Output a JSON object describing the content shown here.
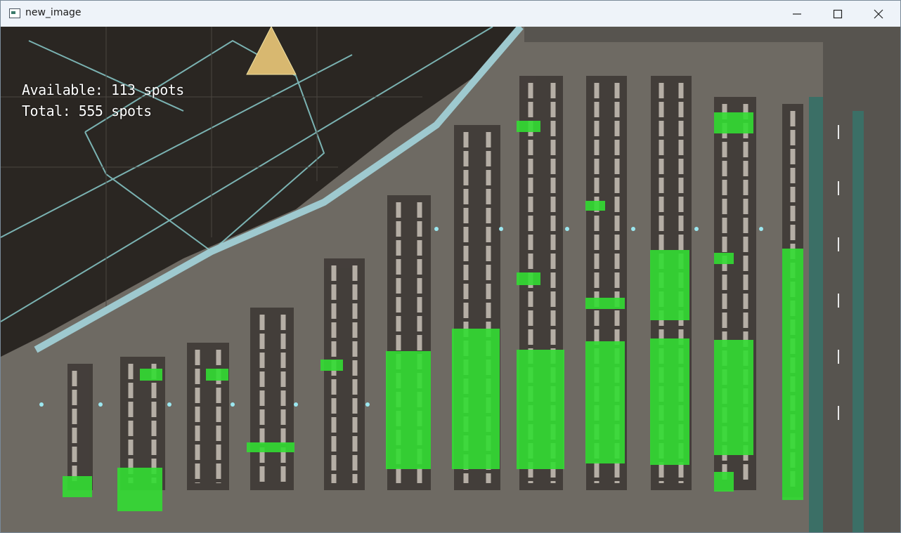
{
  "window": {
    "title": "new_image"
  },
  "controls": {
    "minimize": "minimize",
    "maximize": "maximize",
    "close": "close"
  },
  "overlay": {
    "available": "Available: 113 spots",
    "total": "Total: 555 spots"
  },
  "colors": {
    "free_spot": "#33dd33",
    "asphalt": "#6e6a63",
    "roof": "#2a2622",
    "roof_lines": "#8fd6d6"
  }
}
